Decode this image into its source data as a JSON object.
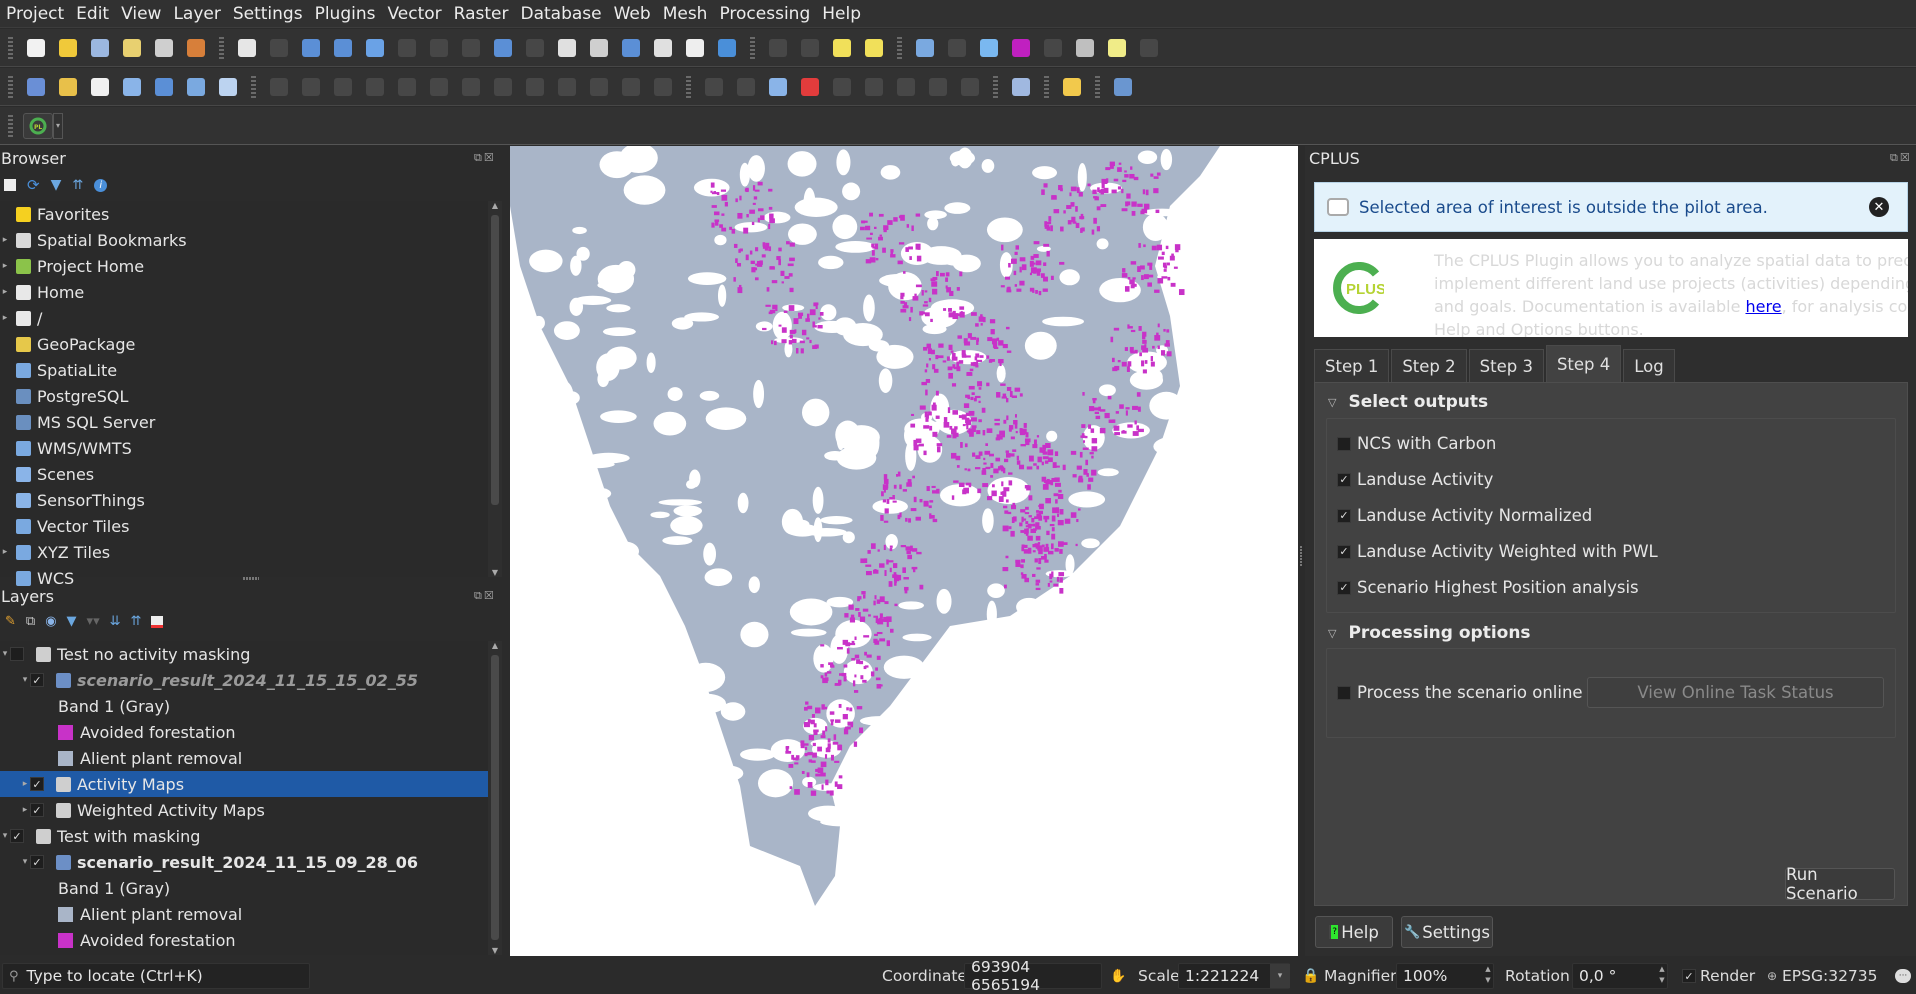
{
  "menu": [
    "Project",
    "Edit",
    "View",
    "Layer",
    "Settings",
    "Plugins",
    "Vector",
    "Raster",
    "Database",
    "Web",
    "Mesh",
    "Processing",
    "Help"
  ],
  "toolbar1_icons": [
    "new-project-icon",
    "open-project-icon",
    "save-project-icon",
    "new-print-layout-icon",
    "layout-manager-icon",
    "style-manager-icon",
    "pan-icon",
    "pan-to-selection-icon",
    "zoom-in-icon",
    "zoom-out-icon",
    "zoom-full-icon",
    "zoom-to-selection-icon",
    "zoom-to-layer-icon",
    "zoom-native-icon",
    "zoom-last-icon",
    "zoom-next-icon",
    "new-map-view-icon",
    "new-3d-map-icon",
    "new-bookmark-icon",
    "show-bookmarks-icon",
    "temporal-controller-icon",
    "refresh-icon",
    "select-features-icon",
    "select-by-value-icon",
    "deselect-icon",
    "select-location-icon",
    "identify-icon",
    "attribute-table-icon",
    "processing-toolbox-icon",
    "statistics-icon",
    "open-field-calculator-icon",
    "measure-icon",
    "map-tips-icon",
    "actions-icon"
  ],
  "toolbar2_icons": [
    "data-source-manager-icon",
    "new-geopackage-layer-icon",
    "new-shapefile-layer-icon",
    "new-spatialite-layer-icon",
    "new-virtual-layer-icon",
    "new-mesh-layer-icon",
    "new-gps-layer-icon",
    "current-edits-icon",
    "toggle-editing-icon",
    "save-edits-icon",
    "digitize-icon",
    "add-polygon-icon",
    "vertex-tool-icon",
    "modify-attributes-icon",
    "delete-selected-icon",
    "cut-features-icon",
    "copy-features-icon",
    "paste-features-icon",
    "undo-icon",
    "redo-icon",
    "label-toolbar-icon",
    "layer-diagram-icon",
    "label-pin-icon",
    "label-highlight-icon",
    "label-show-hide-icon",
    "label-move-icon",
    "label-rotate-icon",
    "label-change-icon",
    "label-edit-icon",
    "metasearch-icon",
    "python-console-icon",
    "help-contents-icon"
  ],
  "plugin_toolbar": {
    "cplus_icon": "cplus-plugin-icon"
  },
  "browser": {
    "title": "Browser",
    "items": [
      {
        "label": "Favorites",
        "icon": "star-icon",
        "expandable": false
      },
      {
        "label": "Spatial Bookmarks",
        "icon": "bookmark-icon",
        "expandable": true
      },
      {
        "label": "Project Home",
        "icon": "project-home-icon",
        "expandable": true
      },
      {
        "label": "Home",
        "icon": "home-icon",
        "expandable": true
      },
      {
        "label": "/",
        "icon": "folder-icon",
        "expandable": true
      },
      {
        "label": "GeoPackage",
        "icon": "geopackage-icon",
        "expandable": false
      },
      {
        "label": "SpatiaLite",
        "icon": "spatialite-icon",
        "expandable": false
      },
      {
        "label": "PostgreSQL",
        "icon": "postgresql-icon",
        "expandable": false
      },
      {
        "label": "MS SQL Server",
        "icon": "mssql-icon",
        "expandable": false
      },
      {
        "label": "WMS/WMTS",
        "icon": "wms-icon",
        "expandable": false
      },
      {
        "label": "Scenes",
        "icon": "scenes-icon",
        "expandable": false
      },
      {
        "label": "SensorThings",
        "icon": "sensorthings-icon",
        "expandable": false
      },
      {
        "label": "Vector Tiles",
        "icon": "vector-tiles-icon",
        "expandable": false
      },
      {
        "label": "XYZ Tiles",
        "icon": "xyz-tiles-icon",
        "expandable": true
      },
      {
        "label": "WCS",
        "icon": "wcs-icon",
        "expandable": false
      }
    ]
  },
  "layers": {
    "title": "Layers",
    "items": [
      {
        "label": "Test no activity masking",
        "level": 0,
        "type": "group",
        "checked": false,
        "expanded": true
      },
      {
        "label": "scenario_result_2024_11_15_15_02_55",
        "level": 1,
        "type": "raster",
        "checked": true,
        "expanded": true,
        "style": "italic-dim"
      },
      {
        "label": "Band 1 (Gray)",
        "level": 2,
        "type": "legend-text"
      },
      {
        "label": "Avoided forestation",
        "level": 2,
        "type": "legend",
        "color": "#c832c8"
      },
      {
        "label": "Alient plant removal",
        "level": 2,
        "type": "legend",
        "color": "#a9b5c8"
      },
      {
        "label": "Activity Maps",
        "level": 1,
        "type": "group",
        "checked": true,
        "expanded": false,
        "selected": true
      },
      {
        "label": "Weighted Activity Maps",
        "level": 1,
        "type": "group",
        "checked": true,
        "expanded": false
      },
      {
        "label": "Test with masking",
        "level": 0,
        "type": "group",
        "checked": true,
        "expanded": true
      },
      {
        "label": "scenario_result_2024_11_15_09_28_06",
        "level": 1,
        "type": "raster",
        "checked": true,
        "expanded": true,
        "style": "bold"
      },
      {
        "label": "Band 1 (Gray)",
        "level": 2,
        "type": "legend-text"
      },
      {
        "label": "Alient plant removal",
        "level": 2,
        "type": "legend",
        "color": "#a9b5c8"
      },
      {
        "label": "Avoided forestation",
        "level": 2,
        "type": "legend",
        "color": "#c832c8"
      }
    ]
  },
  "map": {
    "colors": {
      "avoided_forestation": "#c832c8",
      "alien_plant_removal": "#a9b5c8",
      "background": "#ffffff"
    }
  },
  "cplus": {
    "title": "CPLUS",
    "banner": "Selected area of interest is outside the pilot area.",
    "intro_line1": "The CPLUS Plugin allows you to analyze spatial data to predict",
    "intro_line2": "implement different land use projects (activities) depending",
    "intro_line3_pre": "and goals. Documentation is available ",
    "intro_link": "here",
    "intro_line3_post": ", for analysis configuration",
    "intro_line4": "Help and Options buttons.",
    "logo_text": "PLUS",
    "tabs": [
      "Step 1",
      "Step 2",
      "Step 3",
      "Step 4",
      "Log"
    ],
    "active_tab": "Step 4",
    "select_outputs": {
      "title": "Select outputs",
      "options": [
        {
          "label": "NCS with Carbon",
          "checked": false
        },
        {
          "label": "Landuse Activity",
          "checked": true
        },
        {
          "label": "Landuse Activity Normalized",
          "checked": true
        },
        {
          "label": "Landuse Activity Weighted with PWL",
          "checked": true
        },
        {
          "label": "Scenario Highest Position analysis",
          "checked": true
        }
      ]
    },
    "processing_options": {
      "title": "Processing options",
      "online_label": "Process the scenario online",
      "online_checked": false,
      "view_status_label": "View Online Task Status"
    },
    "run_label": "Run Scenario",
    "help_label": "Help",
    "settings_label": "Settings"
  },
  "status": {
    "locate_placeholder": "Type to locate (Ctrl+K)",
    "coordinate_label": "Coordinate",
    "coordinate_value": "693904  6565194",
    "scale_label": "Scale",
    "scale_value": "1:221224",
    "magnifier_label": "Magnifier",
    "magnifier_value": "100%",
    "rotation_label": "Rotation",
    "rotation_value": "0,0 °",
    "render_label": "Render",
    "render_checked": true,
    "crs": "EPSG:32735"
  }
}
